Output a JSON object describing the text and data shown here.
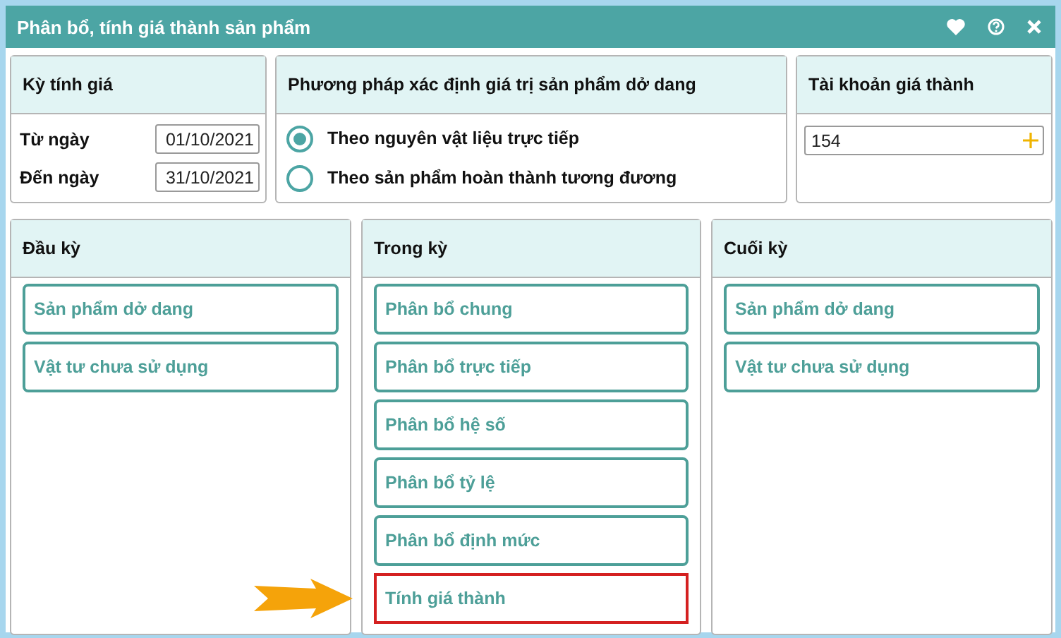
{
  "window": {
    "title": "Phân bổ, tính giá thành sản phẩm"
  },
  "period": {
    "title": "Kỳ tính giá",
    "fields": [
      {
        "label": "Từ ngày",
        "value": "01/10/2021"
      },
      {
        "label": "Đến ngày",
        "value": "31/10/2021"
      }
    ]
  },
  "method": {
    "title": "Phương pháp xác định giá trị sản phẩm dở dang",
    "options": [
      {
        "label": "Theo nguyên vật liệu trực tiếp",
        "selected": true
      },
      {
        "label": "Theo sản phẩm hoàn thành tương đương",
        "selected": false
      }
    ]
  },
  "account": {
    "title": "Tài khoản giá thành",
    "value": "154"
  },
  "columns": [
    {
      "title": "Đầu kỳ",
      "items": [
        {
          "label": "Sản phẩm dở dang",
          "highlighted": false
        },
        {
          "label": "Vật tư chưa sử dụng",
          "highlighted": false
        }
      ]
    },
    {
      "title": "Trong kỳ",
      "items": [
        {
          "label": "Phân bổ chung",
          "highlighted": false
        },
        {
          "label": "Phân bổ trực tiếp",
          "highlighted": false
        },
        {
          "label": "Phân bổ hệ số",
          "highlighted": false
        },
        {
          "label": "Phân bổ tỷ lệ",
          "highlighted": false
        },
        {
          "label": "Phân bổ định mức",
          "highlighted": false
        },
        {
          "label": "Tính giá thành",
          "highlighted": true
        }
      ]
    },
    {
      "title": "Cuối kỳ",
      "items": [
        {
          "label": "Sản phẩm dở dang",
          "highlighted": false
        },
        {
          "label": "Vật tư chưa sử dụng",
          "highlighted": false
        }
      ]
    }
  ]
}
